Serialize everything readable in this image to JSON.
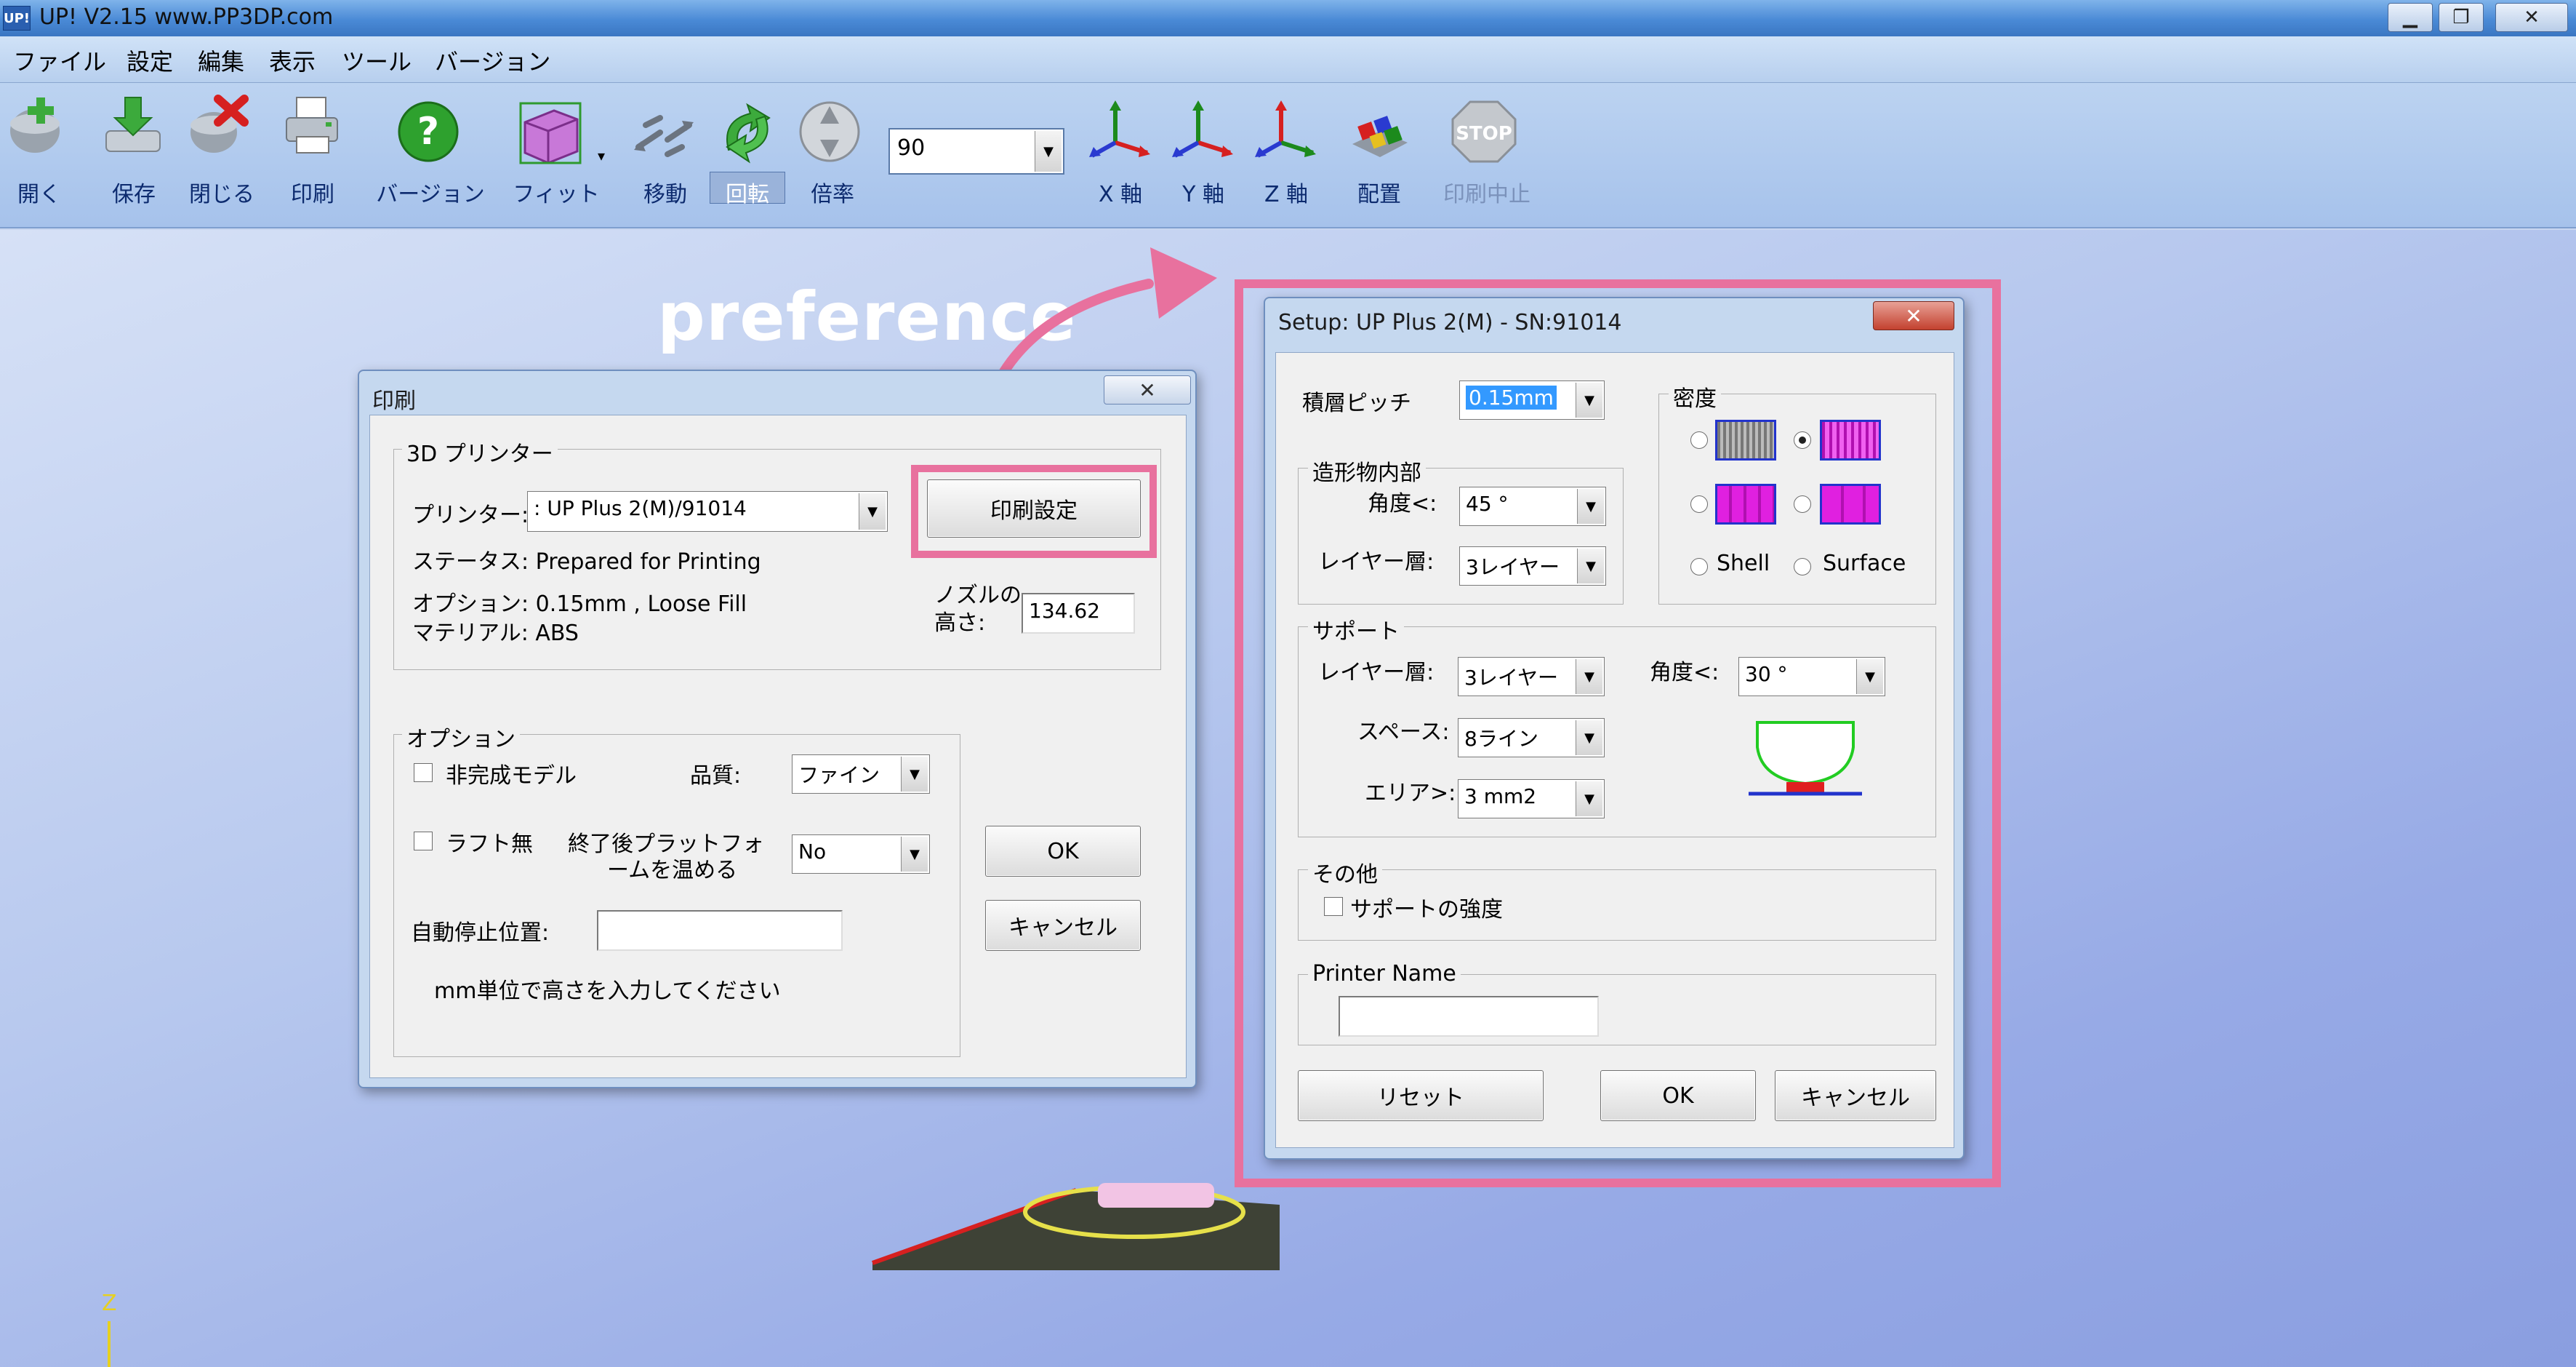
{
  "window": {
    "app_icon_text": "UP!",
    "title": "UP!  V2.15 www.PP3DP.com",
    "buttons": {
      "minimize": "▁",
      "restore": "❐",
      "close": "✕"
    }
  },
  "menu": [
    "ファイル",
    "設定",
    "編集",
    "表示",
    "ツール",
    "バージョン"
  ],
  "toolbar": {
    "buttons": [
      {
        "label": "開く",
        "icon": "open-icon"
      },
      {
        "label": "保存",
        "icon": "save-icon"
      },
      {
        "label": "閉じる",
        "icon": "close-file-icon"
      },
      {
        "label": "印刷",
        "icon": "print-icon"
      },
      {
        "label": "バージョン",
        "icon": "help-icon"
      },
      {
        "label": "フィット",
        "icon": "fit-icon"
      },
      {
        "label": "移動",
        "icon": "move-icon"
      },
      {
        "label": "回転",
        "icon": "rotate-icon"
      },
      {
        "label": "倍率",
        "icon": "scale-icon"
      },
      {
        "label": "X 軸",
        "icon": "x-axis-icon"
      },
      {
        "label": "Y 軸",
        "icon": "y-axis-icon"
      },
      {
        "label": "Z 軸",
        "icon": "z-axis-icon"
      },
      {
        "label": "配置",
        "icon": "arrange-icon"
      },
      {
        "label": "印刷中止",
        "icon": "stop-icon"
      }
    ],
    "stop_icon_text": "STOP",
    "zoom_value": "90"
  },
  "annotation": {
    "text": "preference"
  },
  "print_dialog": {
    "title": "印刷",
    "printer_group": "3D プリンター",
    "printer_label": "プリンター:",
    "printer_value": ": UP Plus 2(M)/91014",
    "settings_button": "印刷設定",
    "status": "ステータス: Prepared for Printing",
    "options_line": "オプション: 0.15mm , Loose Fill",
    "material": "マテリアル: ABS",
    "nozzle_label_1": "ノズルの",
    "nozzle_label_2": "高さ:",
    "nozzle_value": "134.62",
    "options_group": "オプション",
    "incomplete_model": "非完成モデル",
    "quality_label": "品質:",
    "quality_value": "ファイン",
    "no_raft": "ラフト無",
    "heat_label_1": "終了後プラットフォ",
    "heat_label_2": "ームを温める",
    "heat_value": "No",
    "auto_stop_label": "自動停止位置:",
    "auto_stop_value": "",
    "hint": "mm単位で高さを入力してください",
    "ok": "OK",
    "cancel": "キャンセル"
  },
  "setup_dialog": {
    "title": "Setup: UP Plus 2(M) - SN:91014",
    "layer_pitch_label": "積層ピッチ",
    "layer_pitch_value": "0.15mm",
    "interior_group": "造形物内部",
    "interior_angle_label": "角度<:",
    "interior_angle_value": "45 °",
    "interior_layers_label": "レイヤー層:",
    "interior_layers_value": "3レイヤー",
    "density_group": "密度",
    "density_options": [
      "",
      "",
      "",
      "",
      "Shell",
      "Surface"
    ],
    "density_selected_index": 1,
    "support_group": "サポート",
    "support_layers_label": "レイヤー層:",
    "support_layers_value": "3レイヤー",
    "support_angle_label": "角度<:",
    "support_angle_value": "30 °",
    "support_space_label": "スペース:",
    "support_space_value": "8ライン",
    "support_area_label": "エリア>:",
    "support_area_value": "3 mm2",
    "other_group": "その他",
    "support_strength": "サポートの強度",
    "printer_name_group": "Printer Name",
    "printer_name_value": "",
    "reset": "リセット",
    "ok": "OK",
    "cancel": "キャンセル"
  },
  "axis_indicator": {
    "label": "Z"
  },
  "colors": {
    "accent_pink": "#e8719e",
    "title_blue": "#4a8ad6",
    "density_magenta": "#e020e0"
  }
}
